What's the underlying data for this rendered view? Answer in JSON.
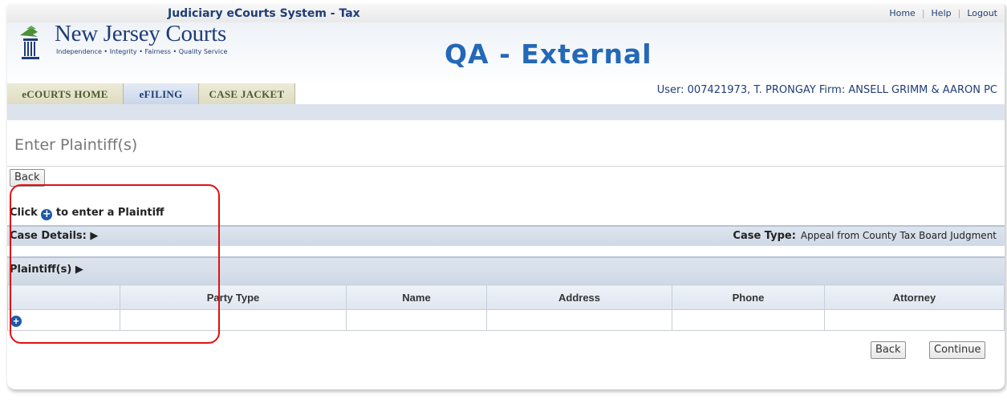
{
  "header": {
    "system_title": "Judiciary eCourts System - Tax",
    "links": [
      "Home",
      "Help",
      "Logout"
    ],
    "logo_title": "New Jersey Courts",
    "logo_tagline": "Independence • Integrity • Fairness • Quality Service",
    "environment": "QA - External",
    "brand_color": "#1f3d78",
    "env_color": "#2468b8"
  },
  "nav": {
    "tabs": [
      "eCOURTS HOME",
      "eFILING",
      "CASE JACKET"
    ],
    "active_tab": "eFILING",
    "user_info": "User: 007421973, T. PRONGAY  Firm: ANSELL GRIMM & AARON PC"
  },
  "page": {
    "title": "Enter Plaintiff(s)",
    "back_label": "Back",
    "click_prefix": "Click",
    "click_suffix": "to enter a Plaintiff",
    "case_details_label": "Case Details: ▶",
    "case_type_label": "Case Type:",
    "case_type_value": "Appeal from County Tax Board Judgment",
    "plaintiffs_label": "Plaintiff(s) ▶"
  },
  "plaintiff_table": {
    "columns": [
      "",
      "Party Type",
      "Name",
      "Address",
      "Phone",
      "Attorney"
    ],
    "rows": []
  },
  "actions": {
    "back_label": "Back",
    "continue_label": "Continue"
  },
  "icons": {
    "add": "plus-circle-icon",
    "expand": "triangle-right-icon"
  },
  "annotation_color": "#e01010"
}
